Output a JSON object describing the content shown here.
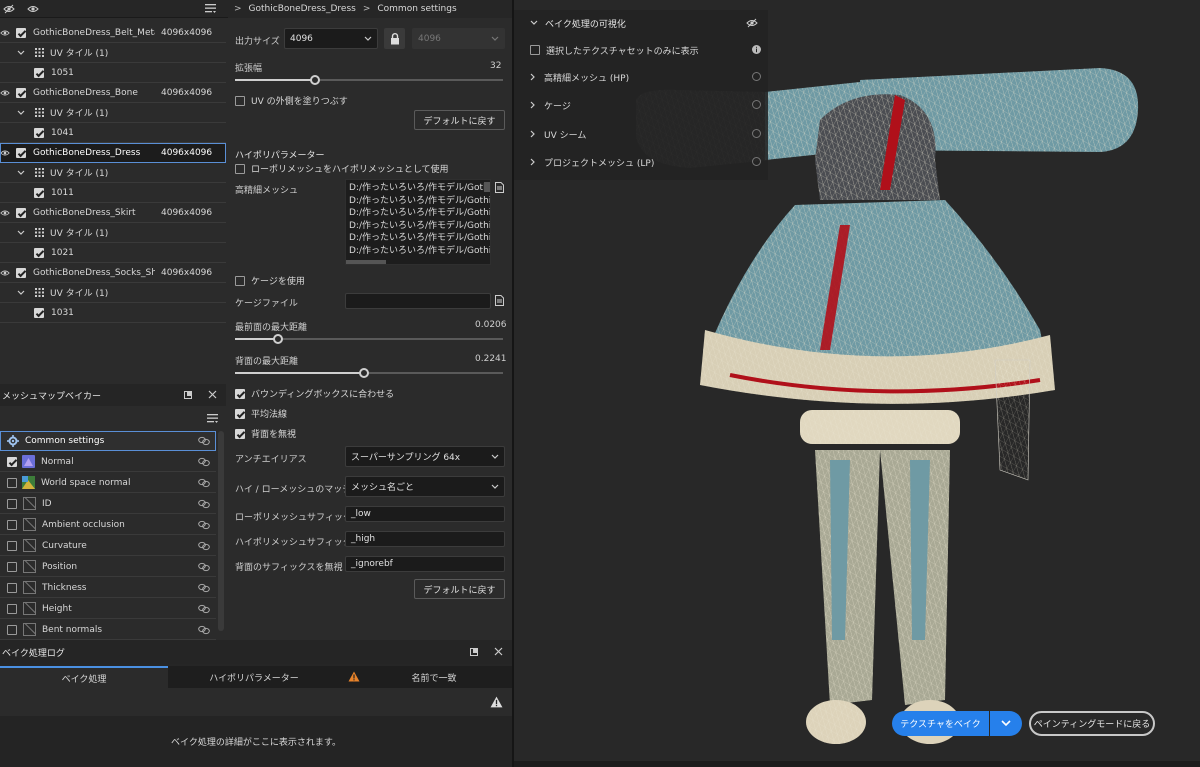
{
  "texture_sets": {
    "items": [
      {
        "name": "GothicBoneDress_Belt_Metal",
        "resolution": "4096x4096",
        "uv_label": "UV タイル (1)",
        "tile": "1051"
      },
      {
        "name": "GothicBoneDress_Bone",
        "resolution": "4096x4096",
        "uv_label": "UV タイル (1)",
        "tile": "1041"
      },
      {
        "name": "GothicBoneDress_Dress",
        "resolution": "4096x4096",
        "uv_label": "UV タイル (1)",
        "tile": "1011"
      },
      {
        "name": "GothicBoneDress_Skirt",
        "resolution": "4096x4096",
        "uv_label": "UV タイル (1)",
        "tile": "1021"
      },
      {
        "name": "GothicBoneDress_Socks_Sh...",
        "resolution": "4096x4096",
        "uv_label": "UV タイル (1)",
        "tile": "1031"
      }
    ]
  },
  "baker": {
    "title": "メッシュマップベイカー",
    "maps": [
      {
        "label": "Common settings"
      },
      {
        "label": "Normal"
      },
      {
        "label": "World space normal"
      },
      {
        "label": "ID"
      },
      {
        "label": "Ambient occlusion"
      },
      {
        "label": "Curvature"
      },
      {
        "label": "Position"
      },
      {
        "label": "Thickness"
      },
      {
        "label": "Height"
      },
      {
        "label": "Bent normals"
      }
    ]
  },
  "breadcrumb": {
    "item1": "GothicBoneDress_Dress",
    "separator": ">",
    "item2": "Common settings"
  },
  "settings": {
    "output_size_label": "出力サイズ",
    "output_size_value": "4096",
    "output_size_linked": "4096",
    "dilation_label": "拡張幅",
    "dilation_value": "32",
    "dilation_fraction": 0.3,
    "fill_outside_uv": "UV の外側を塗りつぶす",
    "reset_button": "デフォルトに戻す",
    "hipoly_section": "ハイポリパラメーター",
    "use_lowpoly_as_high": "ローポリメッシュをハイポリメッシュとして使用",
    "hipoly_mesh_label": "高精細メッシュ",
    "hipoly_paths": [
      "D:/作ったいろいろ/作モデル/GothicB",
      "D:/作ったいろいろ/作モデル/GothicB",
      "D:/作ったいろいろ/作モデル/GothicB",
      "D:/作ったいろいろ/作モデル/GothicB",
      "D:/作ったいろいろ/作モデル/GothicB",
      "D:/作ったいろいろ/作モデル/GothicB"
    ],
    "use_cage": "ケージを使用",
    "cage_file_label": "ケージファイル",
    "max_frontal_label": "最前面の最大距離",
    "max_frontal_value": "0.0206",
    "max_frontal_fraction": 0.16,
    "max_rear_label": "背面の最大距離",
    "max_rear_value": "0.2241",
    "max_rear_fraction": 0.48,
    "match_bbox": "バウンディングボックスに合わせる",
    "average_normals": "平均法線",
    "ignore_backface": "背面を無視",
    "antialiasing_label": "アンチエイリアス",
    "antialiasing_value": "スーパーサンプリング 64x",
    "matching_label": "ハイ / ローメッシュのマッチング",
    "matching_value": "メッシュ名ごと",
    "low_suffix_label": "ローポリメッシュサフィックス",
    "low_suffix_value": "_low",
    "high_suffix_label": "ハイポリメッシュサフィックス",
    "high_suffix_value": "_high",
    "ignore_suffix_label": "背面のサフィックスを無視",
    "ignore_suffix_value": "_ignorebf",
    "reset_button2": "デフォルトに戻す"
  },
  "log": {
    "title": "ベイク処理ログ",
    "tabs": [
      "ベイク処理",
      "ハイポリパラメーター",
      "名前で一致"
    ],
    "message": "ベイク処理の詳細がここに表示されます。"
  },
  "viewport": {
    "overlay": [
      "ベイク処理の可視化",
      "選択したテクスチャセットのみに表示",
      "高精細メッシュ (HP)",
      "ケージ",
      "UV シーム",
      "プロジェクトメッシュ (LP)"
    ],
    "bake_button": "テクスチャをベイク",
    "paint_button": "ペインティングモードに戻る"
  },
  "colors": {
    "accent": "#2680eb",
    "selection": "#5a8fd6",
    "warning": "#e8832a",
    "dress_red": "#b0101a",
    "dress_teal": "#6f9aa4",
    "lace": "#e8dcc0"
  }
}
